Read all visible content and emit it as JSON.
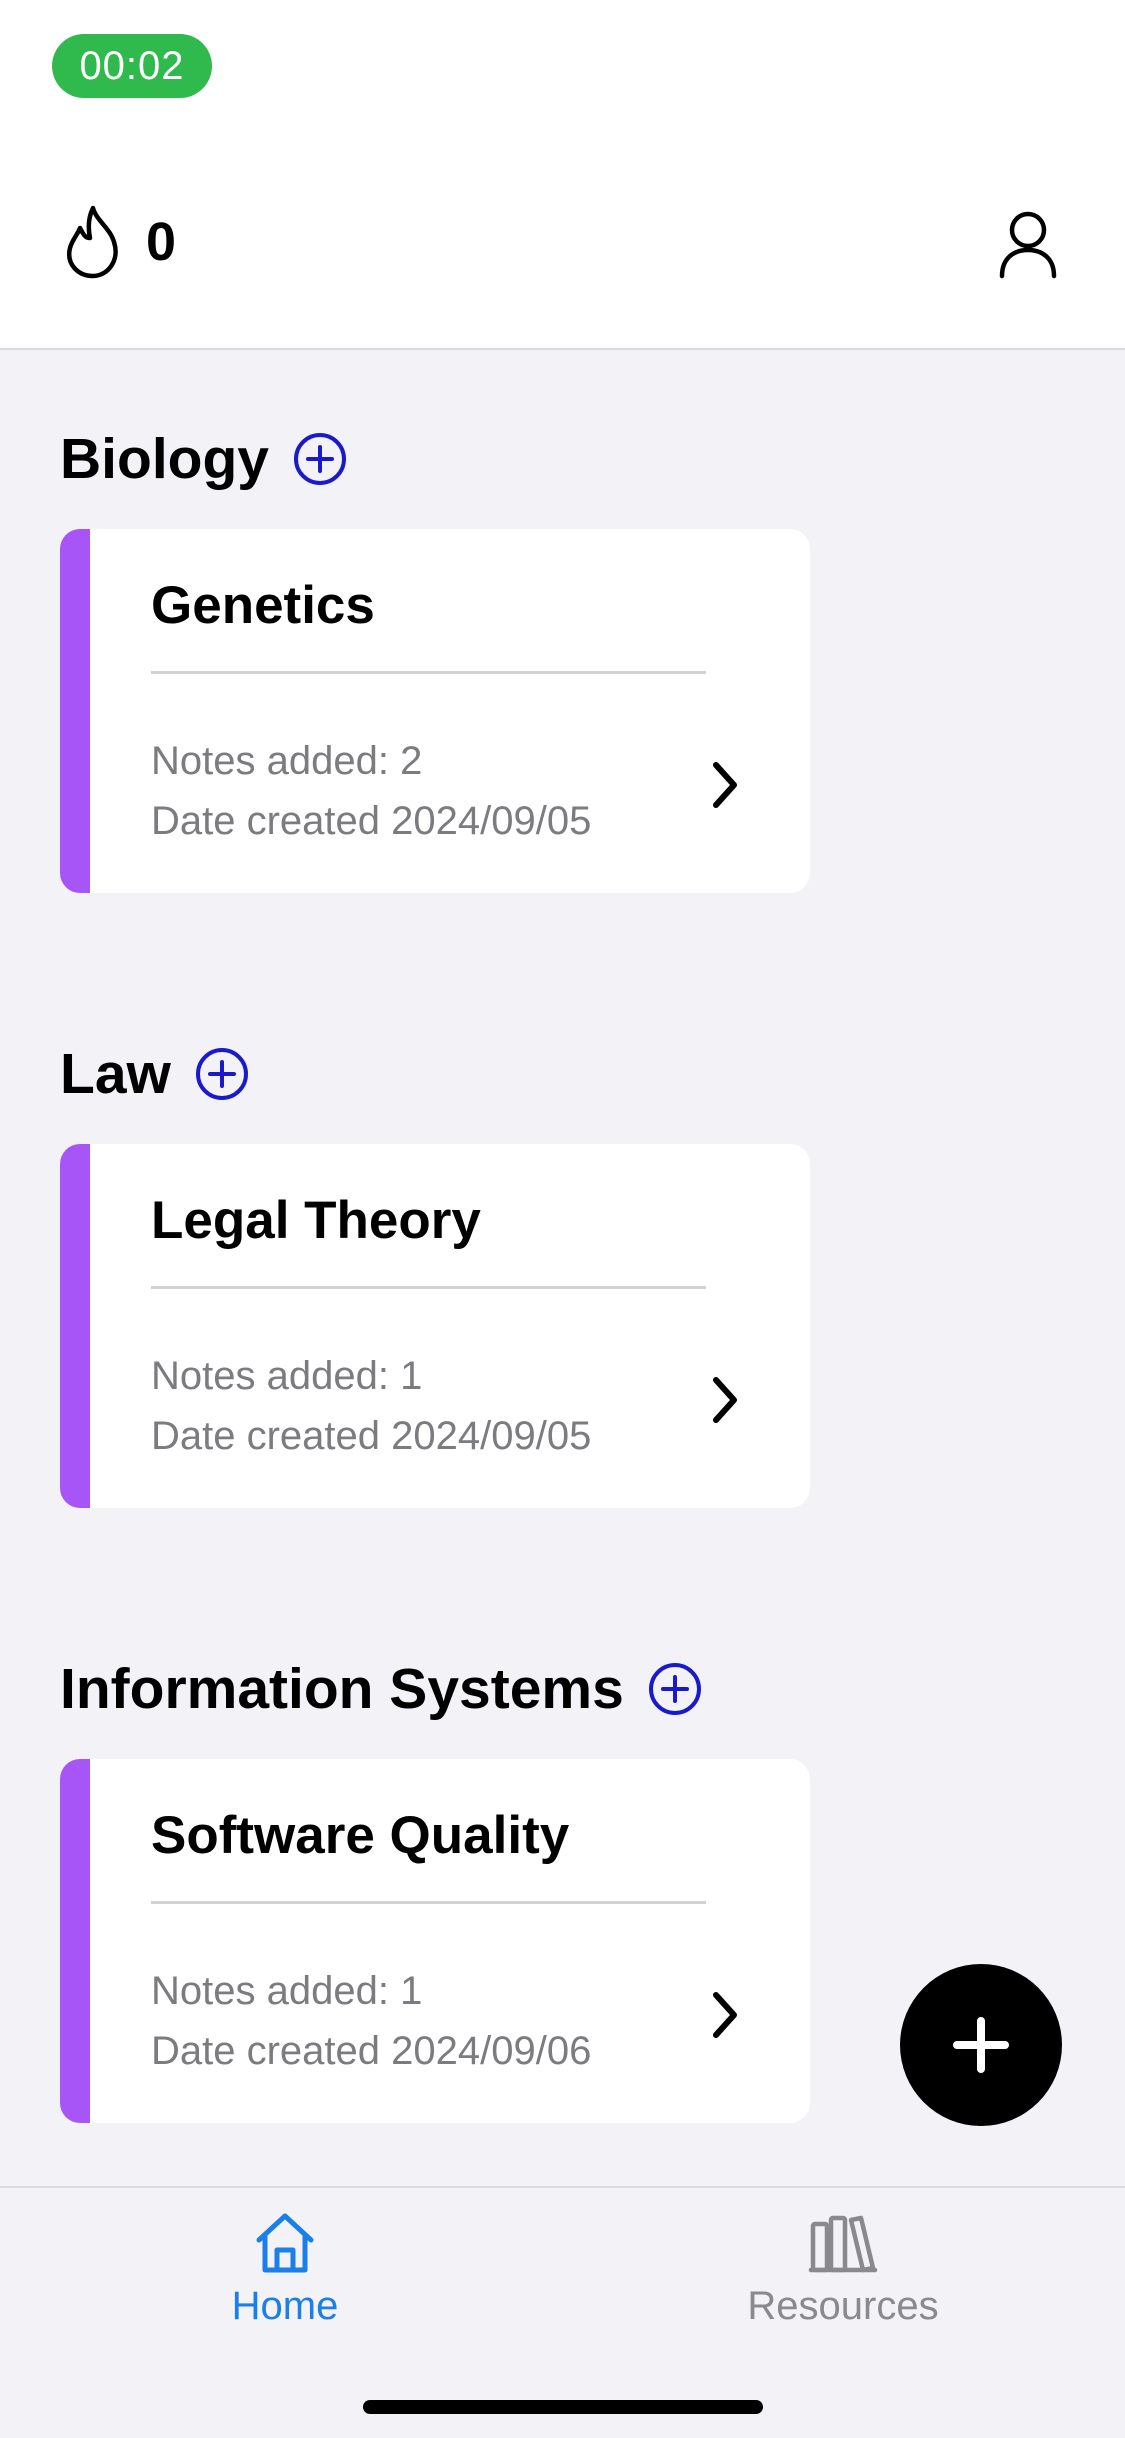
{
  "status_bar": {
    "timer": "00:02"
  },
  "header": {
    "streak_icon": "flame-icon",
    "streak_count": "0",
    "profile_icon": "person-icon"
  },
  "sections": [
    {
      "title": "Biology",
      "card": {
        "title": "Genetics",
        "notes": "Notes added: 2",
        "date": "Date created 2024/09/05"
      }
    },
    {
      "title": "Law",
      "card": {
        "title": "Legal Theory",
        "notes": "Notes added: 1",
        "date": "Date created 2024/09/05"
      }
    },
    {
      "title": "Information Systems",
      "card": {
        "title": "Software Quality",
        "notes": "Notes added: 1",
        "date": "Date created 2024/09/06"
      }
    }
  ],
  "fab": {
    "icon": "plus-icon"
  },
  "tab_bar": {
    "tabs": [
      {
        "label": "Home",
        "icon": "home-icon",
        "active": true
      },
      {
        "label": "Resources",
        "icon": "books-icon",
        "active": false
      }
    ]
  },
  "colors": {
    "accent_purple": "#a855f7",
    "add_blue": "#1a1acc",
    "tab_active": "#1a7fe8",
    "tab_inactive": "#8a8a8e",
    "timer_green": "#30b94d"
  }
}
